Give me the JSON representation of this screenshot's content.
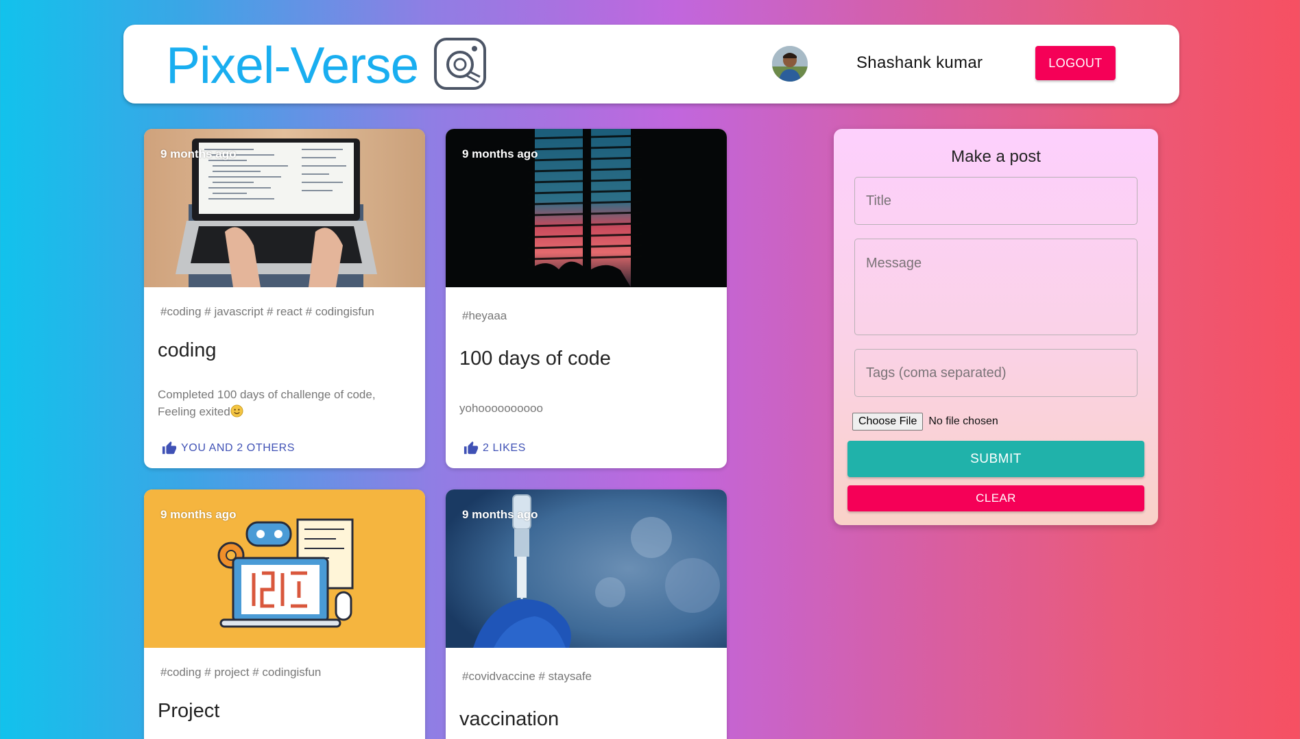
{
  "header": {
    "brand": "Pixel-Verse",
    "brand_icon": "camera-logo-icon",
    "user_name": "Shashank kumar",
    "logout_label": "LOGOUT"
  },
  "posts": [
    {
      "time": "9 months ago",
      "tags": "#coding # javascript # react # codingisfun",
      "title": "coding",
      "message": "Completed 100 days of challenge of code, Feeling exited",
      "likes": "YOU AND 2 OTHERS"
    },
    {
      "time": "9 months ago",
      "tags": "#heyaaa",
      "title": "100 days of code",
      "message": "yohoooooooooo",
      "likes": "2 LIKES"
    },
    {
      "time": "9 months ago",
      "tags": "#coding # project # codingisfun",
      "title": "Project"
    },
    {
      "time": "9 months ago",
      "tags": "#covidvaccine # staysafe",
      "title": "vaccination"
    }
  ],
  "form": {
    "heading": "Make a post",
    "title_placeholder": "Title",
    "message_placeholder": "Message",
    "tags_placeholder": "Tags (coma separated)",
    "file_button": "Choose File",
    "file_status": "No file chosen",
    "submit_label": "SUBMIT",
    "clear_label": "CLEAR"
  },
  "colors": {
    "brand": "#19aef0",
    "logout": "#f50057",
    "submit": "#20b2aa",
    "clear": "#f50057",
    "like": "#3f51b5"
  }
}
